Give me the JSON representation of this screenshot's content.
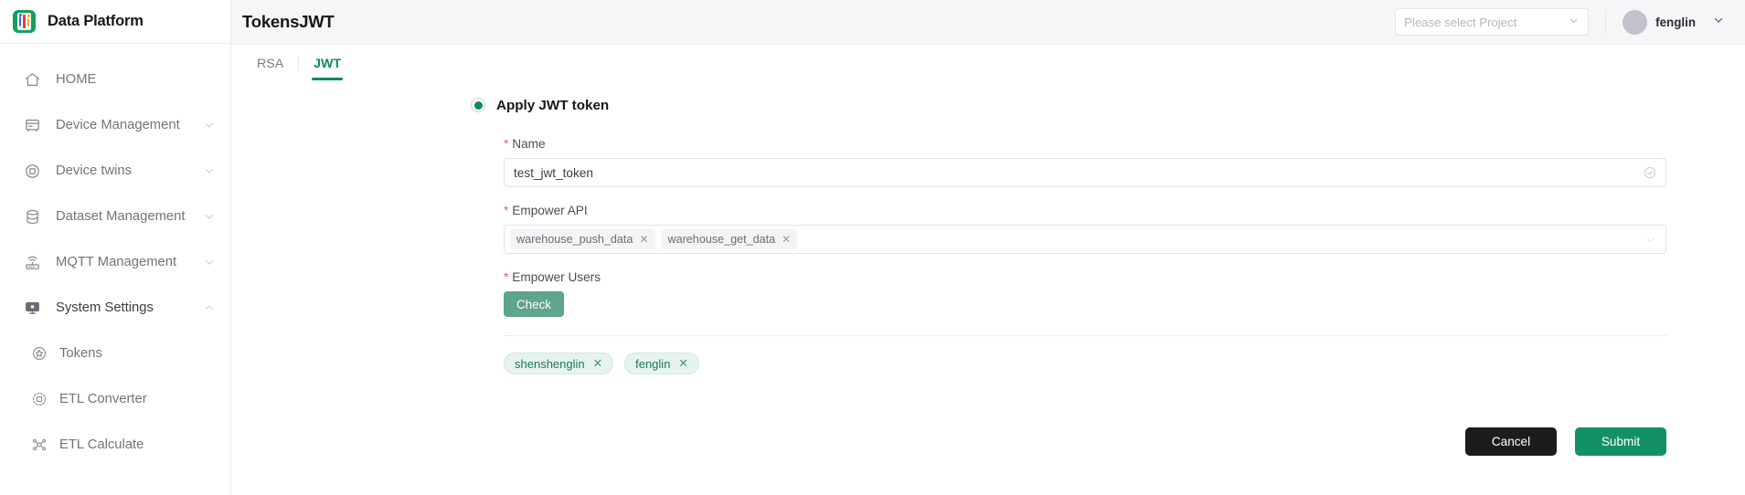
{
  "brand": {
    "title": "Data Platform",
    "logo_icon": "data-platform-logo"
  },
  "sidebar": {
    "items": [
      {
        "label": "HOME",
        "icon": "home-icon",
        "chevron": null
      },
      {
        "label": "Device Management",
        "icon": "server-icon",
        "chevron": "chevron-down-icon"
      },
      {
        "label": "Device twins",
        "icon": "twins-icon",
        "chevron": "chevron-down-icon"
      },
      {
        "label": "Dataset Management",
        "icon": "database-icon",
        "chevron": "chevron-down-icon"
      },
      {
        "label": "MQTT Management",
        "icon": "router-icon",
        "chevron": "chevron-down-icon"
      },
      {
        "label": "System Settings",
        "icon": "monitor-icon",
        "chevron": "chevron-up-icon"
      }
    ],
    "subitems": [
      {
        "label": "Tokens",
        "icon": "star-circle-icon"
      },
      {
        "label": "ETL Converter",
        "icon": "converter-icon"
      },
      {
        "label": "ETL Calculate",
        "icon": "calculate-icon"
      }
    ]
  },
  "header": {
    "title": "TokensJWT",
    "project_select": {
      "placeholder": "Please select Project",
      "value": "",
      "chevron": "chevron-down-icon"
    },
    "user": {
      "name": "fenglin",
      "chevron": "chevron-down-icon",
      "avatar": "avatar"
    }
  },
  "tabs": [
    {
      "label": "RSA",
      "active": false
    },
    {
      "label": "JWT",
      "active": true
    }
  ],
  "form": {
    "radio": {
      "label": "Apply JWT token",
      "checked": true
    },
    "name_field": {
      "label": "Name",
      "required": "*",
      "value": "test_jwt_token",
      "placeholder": "",
      "suffix_icon": "check-circle-icon"
    },
    "empower_api": {
      "label": "Empower API",
      "required": "*",
      "tags": [
        "warehouse_push_data",
        "warehouse_get_data"
      ],
      "close_glyph": "✕",
      "chevron": "chevron-down-icon"
    },
    "empower_users": {
      "label": "Empower Users",
      "required": "*",
      "check_label": "Check",
      "tags": [
        "shenshenglin",
        "fenglin"
      ],
      "close_glyph": "✕"
    }
  },
  "footer": {
    "cancel_label": "Cancel",
    "submit_label": "Submit"
  },
  "colors": {
    "accent_green": "#0e8a62",
    "submit_green": "#149066",
    "check_green": "#5fa58b",
    "cancel_black": "#1c1c1e",
    "required_red": "#f45d5d",
    "tag_green_bg": "#e7f4ee",
    "tag_green_text": "#1c7a59"
  }
}
